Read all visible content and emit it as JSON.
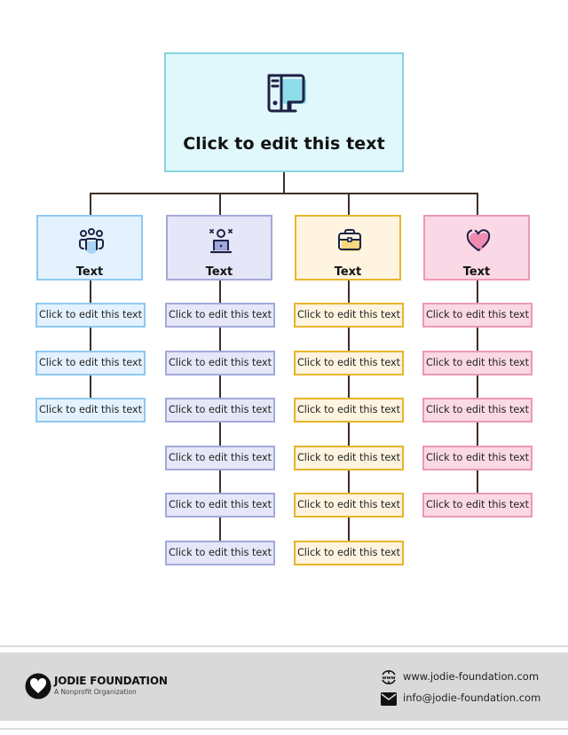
{
  "colors": {
    "connector": "#3d2f24",
    "top": {
      "fill": "#e0f7fb",
      "border": "#86d3dd",
      "accent": "#8fdcea"
    },
    "blue": {
      "fill": "#e3f2fe",
      "border": "#90c8f0",
      "accent": "#a8d4f5"
    },
    "purple": {
      "fill": "#e5e7f8",
      "border": "#a3a9d8",
      "accent": "#9fa5dd"
    },
    "yellow": {
      "fill": "#fef4df",
      "border": "#e7b52a",
      "accent": "#f8d77e"
    },
    "pink": {
      "fill": "#fbd8e5",
      "border": "#ec98b5",
      "accent": "#f08bb0"
    },
    "footer": "#d9d9d9"
  },
  "top": {
    "icon": "computer-desktop-icon",
    "title": "Click to edit this text"
  },
  "columns": [
    {
      "key": "blue",
      "icon": "team-people-icon",
      "label": "Text",
      "items": [
        "Click to edit this text",
        "Click to edit this text",
        "Click to edit this text"
      ]
    },
    {
      "key": "purple",
      "icon": "person-laptop-icon",
      "label": "Text",
      "items": [
        "Click to edit this text",
        "Click to edit this text",
        "Click to edit this text",
        "Click to edit this text",
        "Click to edit this text",
        "Click to edit this text"
      ]
    },
    {
      "key": "yellow",
      "icon": "briefcase-icon",
      "label": "Text",
      "items": [
        "Click to edit this text",
        "Click to edit this text",
        "Click to edit this text",
        "Click to edit this text",
        "Click to edit this text",
        "Click to edit this text"
      ]
    },
    {
      "key": "pink",
      "icon": "heart-icon",
      "label": "Text",
      "items": [
        "Click to edit this text",
        "Click to edit this text",
        "Click to edit this text",
        "Click to edit this text",
        "Click to edit this text"
      ]
    }
  ],
  "footer": {
    "brand_name": "JODIE FOUNDATION",
    "brand_tagline": "A Nonprofit Organization",
    "logo_icon": "heart-circle-logo-icon",
    "website_icon": "www-globe-icon",
    "website": "www.jodie-foundation.com",
    "email_icon": "envelope-icon",
    "email": "info@jodie-foundation.com"
  }
}
